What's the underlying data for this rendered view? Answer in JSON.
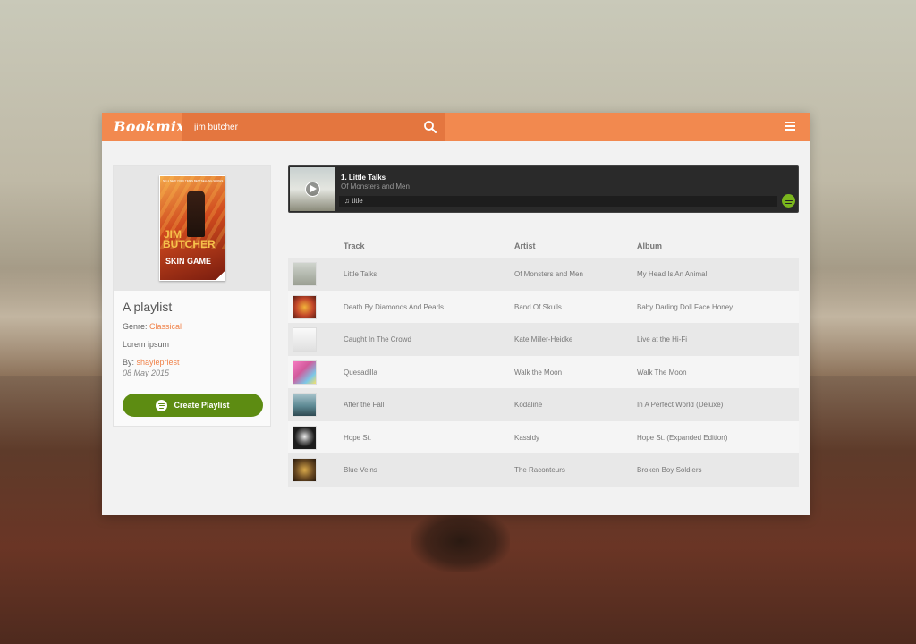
{
  "app": {
    "logo": "Bookmix",
    "search": {
      "value": "jim butcher",
      "placeholder": ""
    }
  },
  "playlist": {
    "cover": {
      "top_text": "NO.1 NEW YORK TIMES BESTSELLING SERIES",
      "author_line1": "JIM",
      "author_line2": "BUTCHER",
      "book_title": "SKIN GAME"
    },
    "title": "A playlist",
    "genre_label": "Genre:",
    "genre_value": "Classical",
    "description": "Lorem ipsum",
    "by_label": "By:",
    "author": "shaylepriest",
    "date": "08 May 2015",
    "create_button": "Create Playlist"
  },
  "player": {
    "now_playing_title": "1. Little Talks",
    "now_playing_artist": "Of Monsters and Men",
    "bar_label": "♫ title"
  },
  "table": {
    "headers": {
      "track": "Track",
      "artist": "Artist",
      "album": "Album"
    },
    "rows": [
      {
        "track": "Little Talks",
        "artist": "Of Monsters and Men",
        "album": "My Head Is An Animal",
        "art_color": "#b9c0b5"
      },
      {
        "track": "Death By Diamonds And Pearls",
        "artist": "Band Of Skulls",
        "album": "Baby Darling Doll Face Honey",
        "art_color": "#c2462a"
      },
      {
        "track": "Caught In The Crowd",
        "artist": "Kate Miller-Heidke",
        "album": "Live at the Hi-Fi",
        "art_color": "#eeeeee"
      },
      {
        "track": "Quesadilla",
        "artist": "Walk the Moon",
        "album": "Walk The Moon",
        "art_color": "#d25a9c"
      },
      {
        "track": "After the Fall",
        "artist": "Kodaline",
        "album": "In A Perfect World (Deluxe)",
        "art_color": "#5e8a94"
      },
      {
        "track": "Hope St.",
        "artist": "Kassidy",
        "album": "Hope St. (Expanded Edition)",
        "art_color": "#2a2a2a"
      },
      {
        "track": "Blue Veins",
        "artist": "The Raconteurs",
        "album": "Broken Boy Soldiers",
        "art_color": "#6a4a22"
      }
    ]
  },
  "colors": {
    "accent": "#f2894f",
    "search_bg": "#e4763f",
    "link": "#f0834a",
    "create_button": "#5d8c12",
    "spotify": "#7ab51d"
  }
}
